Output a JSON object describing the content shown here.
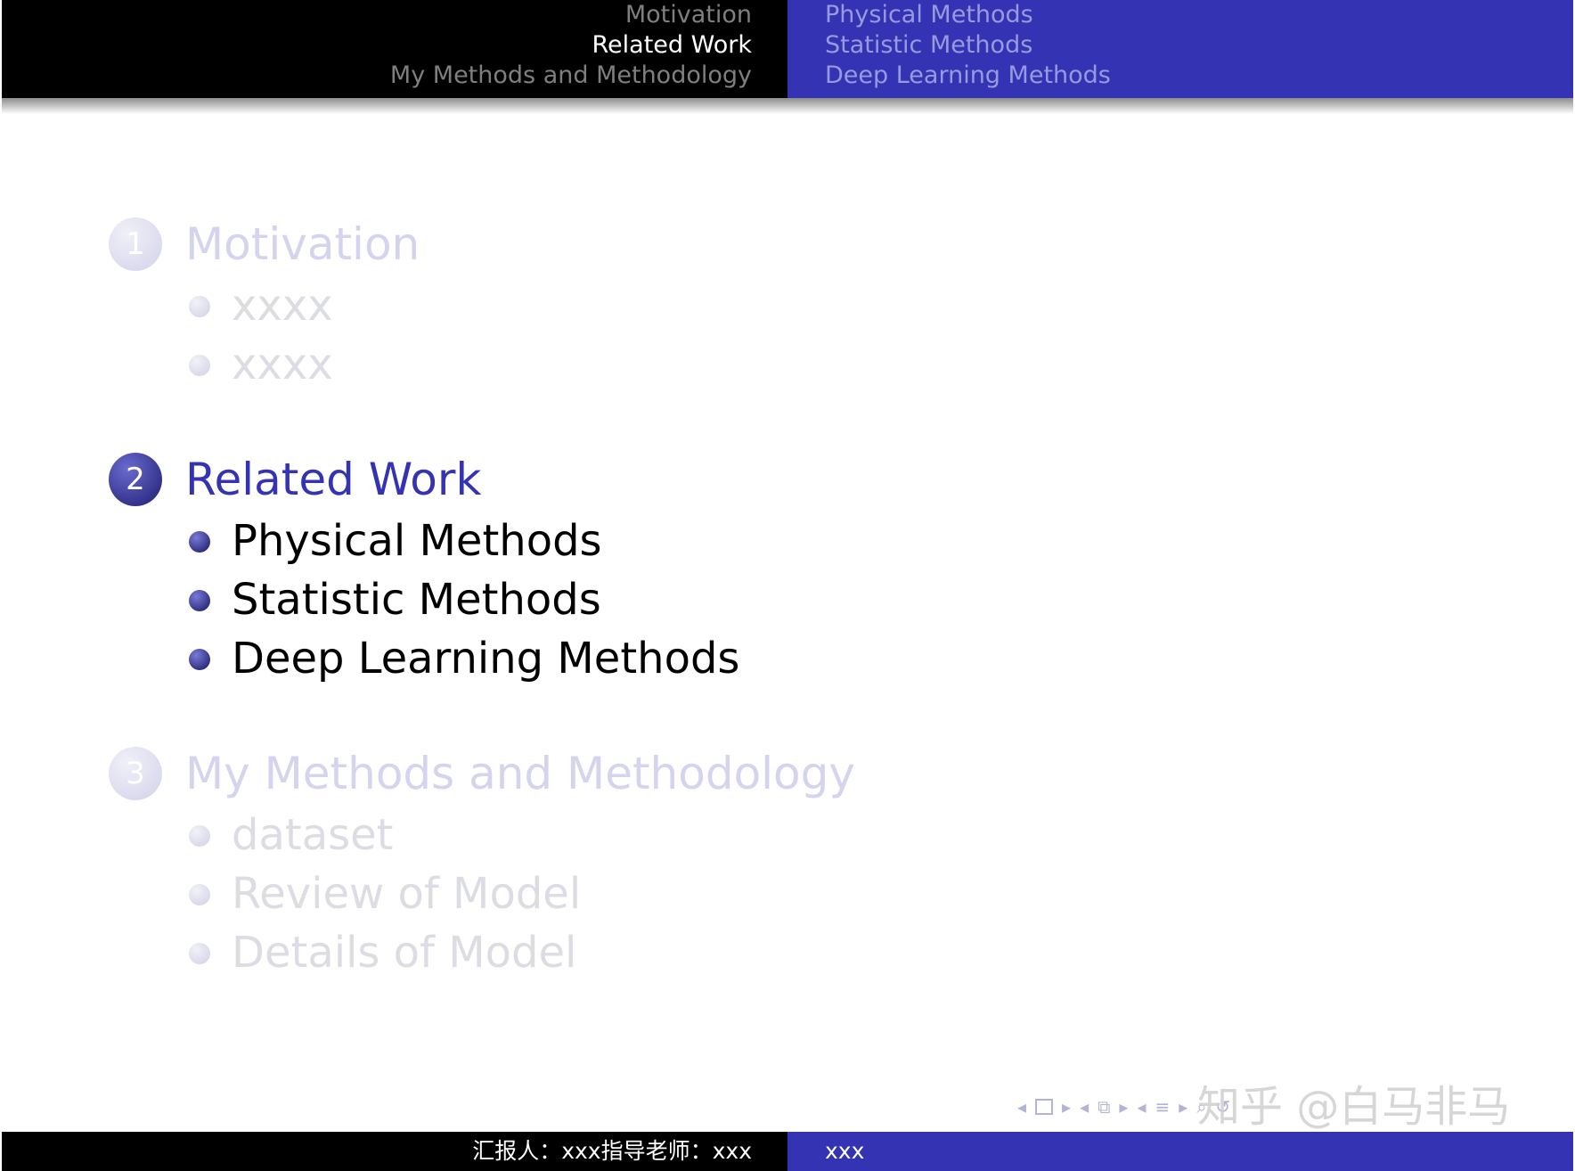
{
  "header": {
    "sections": [
      "Motivation",
      "Related Work",
      "My Methods and Methodology"
    ],
    "subsections": [
      "Physical Methods",
      "Statistic Methods",
      "Deep Learning Methods"
    ]
  },
  "toc": [
    {
      "number": "1",
      "title": "Motivation",
      "items": [
        "xxxx",
        "xxxx"
      ],
      "state": "dimmed"
    },
    {
      "number": "2",
      "title": "Related Work",
      "items": [
        "Physical Methods",
        "Statistic Methods",
        "Deep Learning Methods"
      ],
      "state": "active"
    },
    {
      "number": "3",
      "title": "My Methods and Methodology",
      "items": [
        "dataset",
        "Review of Model",
        "Details of Model"
      ],
      "state": "dimmed"
    }
  ],
  "footer": {
    "left": "汇报人：xxx指导老师：xxx",
    "right": "xxx"
  },
  "watermark": "知乎 @白马非马",
  "colors": {
    "accent": "#3333b3",
    "header_dark": "#000000"
  }
}
